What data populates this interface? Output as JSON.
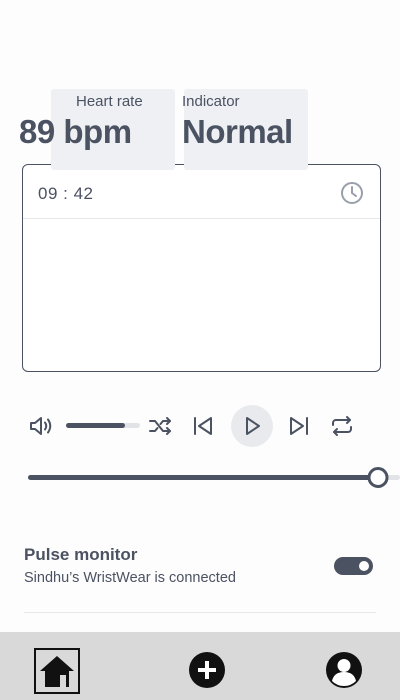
{
  "card": {
    "time": "09 : 42",
    "heart_rate_label": "Heart rate",
    "heart_rate_value": "89 bpm",
    "indicator_label": "Indicator",
    "indicator_value": "Normal"
  },
  "player": {
    "volume_level": 0.8,
    "progress_level": 0.94
  },
  "pulse_monitor": {
    "title": "Pulse monitor",
    "subtitle": "Sindhu’s WristWear is connected",
    "enabled": true
  },
  "icons": {
    "clock": "clock-icon",
    "volume": "volume-icon",
    "shuffle": "shuffle-icon",
    "previous": "skip-previous-icon",
    "play": "play-icon",
    "next": "skip-next-icon",
    "repeat": "repeat-icon",
    "home": "home-icon",
    "add": "add-icon",
    "profile": "profile-icon"
  },
  "colors": {
    "primary": "#4b5262",
    "metric_bg": "#eef0f3",
    "nav_bg": "#d9d9d9"
  }
}
